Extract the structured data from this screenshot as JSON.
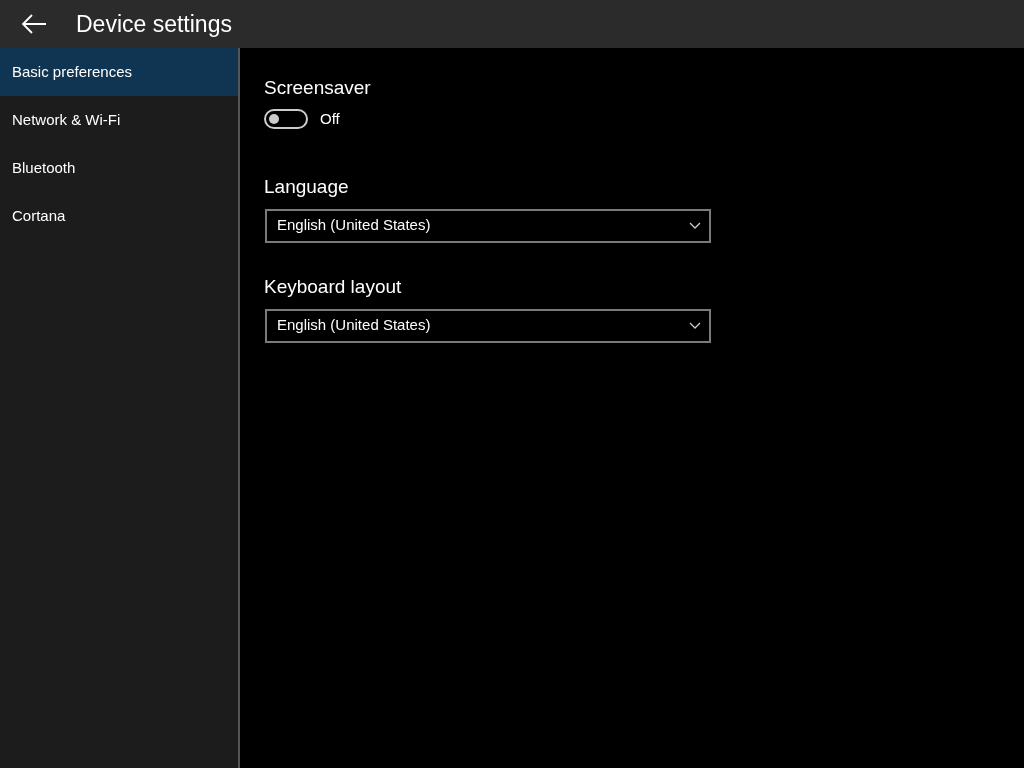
{
  "window": {
    "title": "Device settings"
  },
  "sidebar": {
    "items": [
      {
        "label": "Basic preferences",
        "selected": true
      },
      {
        "label": "Network & Wi-Fi",
        "selected": false
      },
      {
        "label": "Bluetooth",
        "selected": false
      },
      {
        "label": "Cortana",
        "selected": false
      }
    ]
  },
  "settings": [
    {
      "kind": "toggle",
      "label": "Screensaver",
      "on": false,
      "state_text": "Off"
    },
    {
      "kind": "dropdown",
      "label": "Language",
      "value": "English (United States)"
    },
    {
      "kind": "dropdown",
      "label": "Keyboard layout",
      "value": "English (United States)"
    }
  ]
}
